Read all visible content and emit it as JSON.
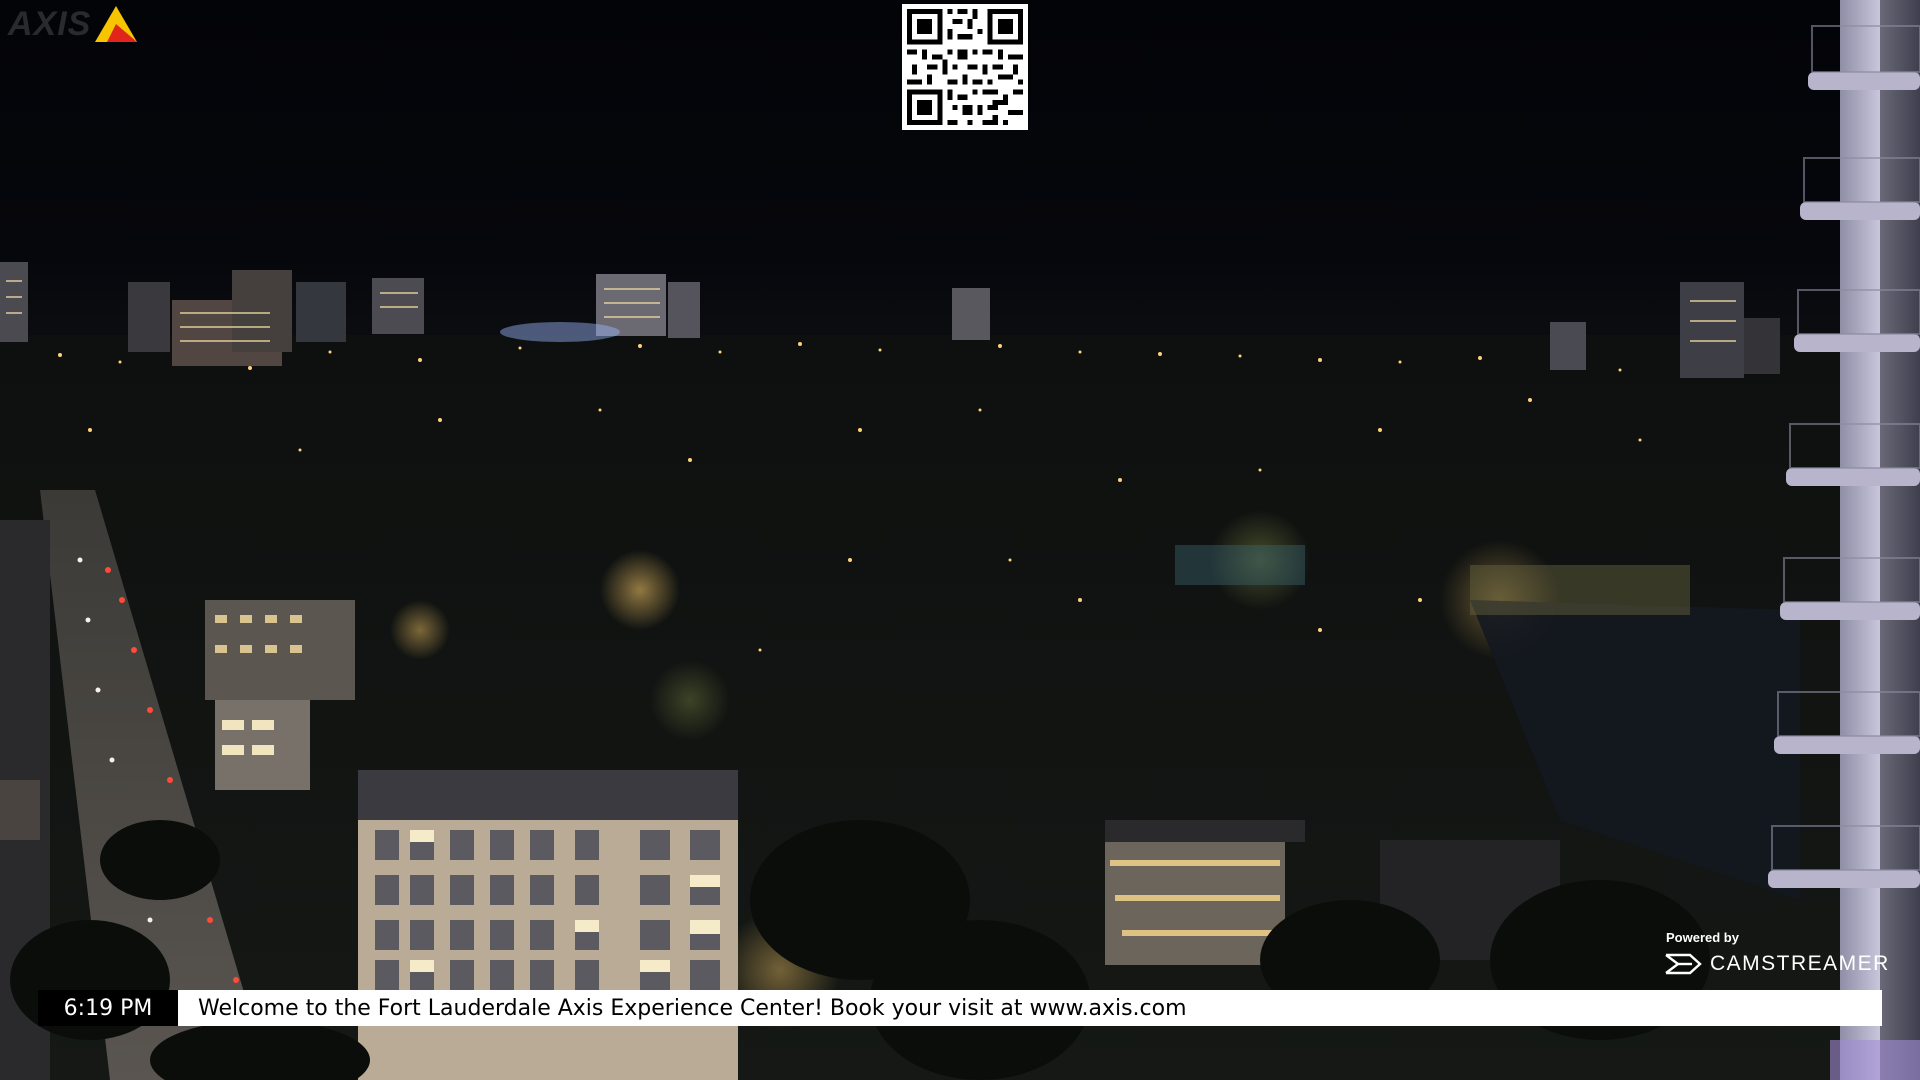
{
  "logo": {
    "text": "AXIS",
    "icon": "axis-triangle-icon",
    "colors": {
      "yellow": "#f7c500",
      "red": "#e1251b"
    }
  },
  "qr_code": {
    "icon": "qr-code-icon"
  },
  "overlay": {
    "powered_by_label": "Powered by",
    "brand_name": "CAMSTREAMER",
    "brand_icon": "camstreamer-icon"
  },
  "ticker": {
    "time": "6:19 PM",
    "message": "Welcome to the Fort Lauderdale Axis Experience Center! Book your visit at www.axis.com"
  }
}
